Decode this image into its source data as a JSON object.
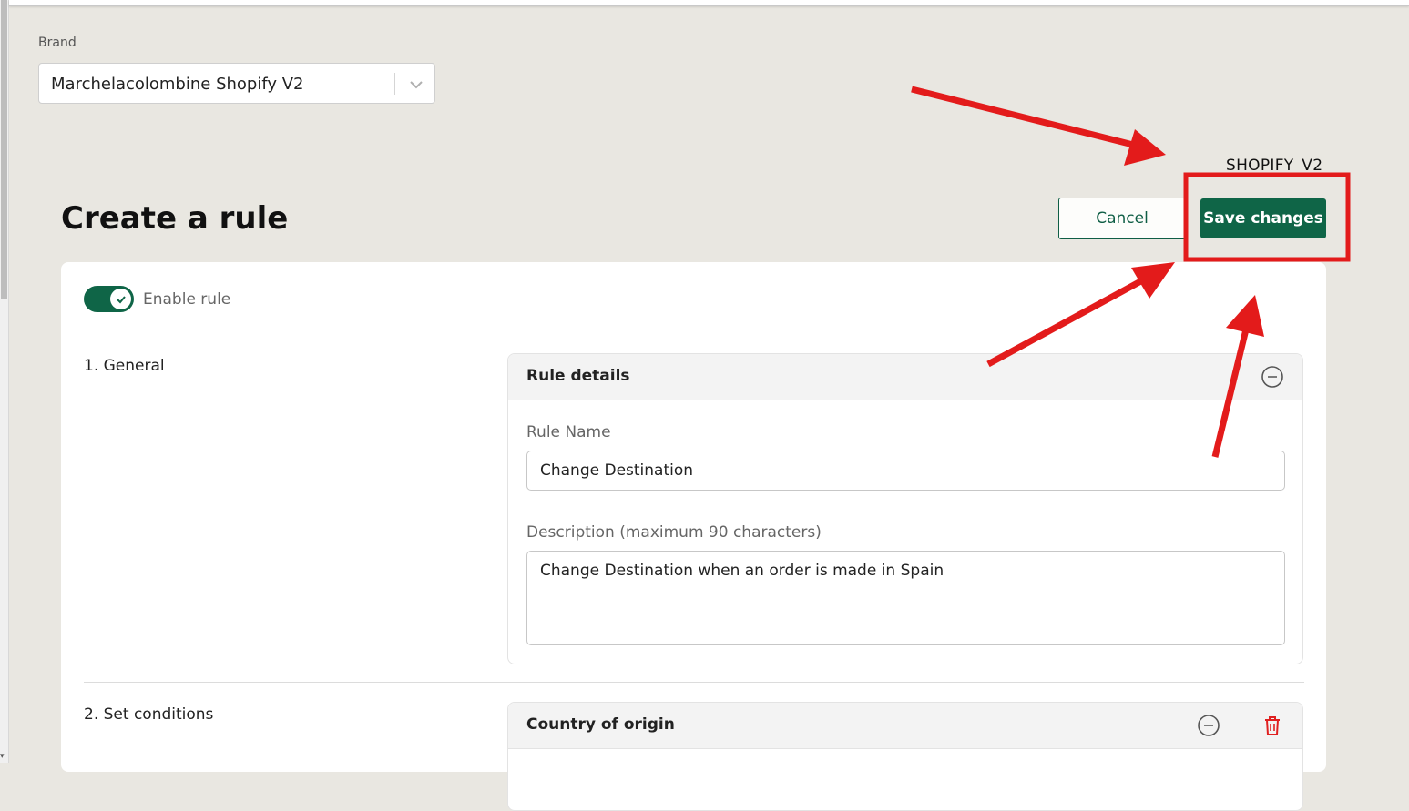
{
  "brand": {
    "label": "Brand",
    "selected": "Marchelacolombine Shopify V2"
  },
  "store_label": "SHOPIFY_V2",
  "page": {
    "title": "Create a rule",
    "cancel_label": "Cancel",
    "save_label": "Save changes"
  },
  "rule": {
    "enable_label": "Enable rule",
    "enabled": true,
    "general": {
      "section_title": "1. General",
      "panel_title": "Rule details",
      "name_label": "Rule Name",
      "name_value": "Change Destination",
      "description_label": "Description (maximum 90 characters)",
      "description_value": "Change Destination when an order is made in Spain"
    },
    "conditions": {
      "section_title": "2. Set conditions",
      "panel_title": "Country of origin"
    }
  },
  "colors": {
    "primary": "#0f6547",
    "annotation": "#e31b1b",
    "background": "#e9e7e1"
  },
  "icons": [
    "chevron-down-icon",
    "check-icon",
    "collapse-icon",
    "trash-icon"
  ]
}
